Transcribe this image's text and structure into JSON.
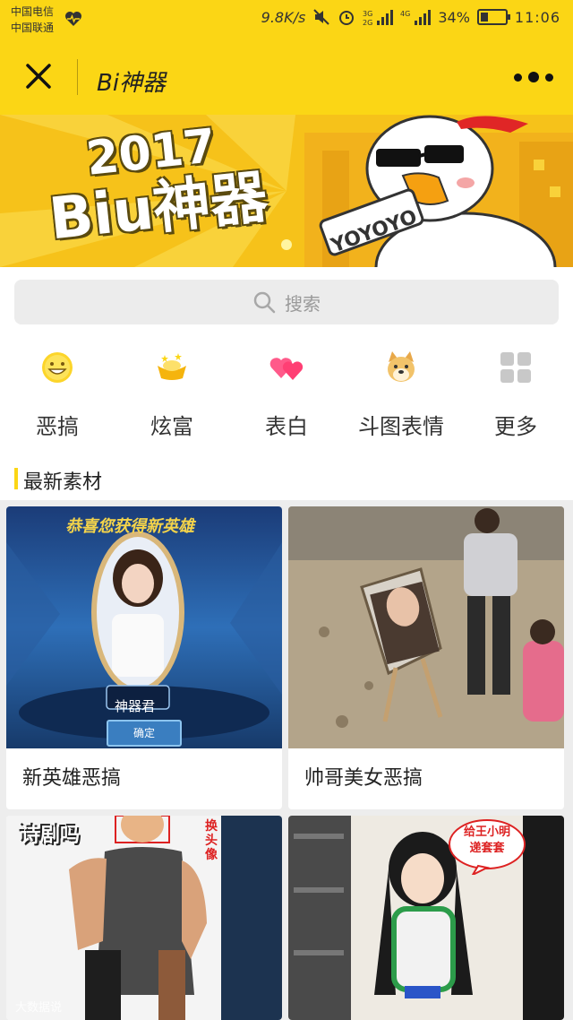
{
  "status": {
    "carrier1": "中国电信",
    "carrier2": "中国联通",
    "speed": "9.8K/s",
    "battery": "34%",
    "time": "11:06"
  },
  "nav": {
    "title": "Bi神器"
  },
  "banner": {
    "year": "2017",
    "name": "Biu神器",
    "sticker": "YOYOYO"
  },
  "search": {
    "placeholder": "搜索"
  },
  "categories": [
    {
      "label": "恶搞",
      "icon": "smiley-face-icon"
    },
    {
      "label": "炫富",
      "icon": "gold-ingot-icon"
    },
    {
      "label": "表白",
      "icon": "hearts-icon"
    },
    {
      "label": "斗图表情",
      "icon": "doge-icon"
    },
    {
      "label": "更多",
      "icon": "grid-icon"
    }
  ],
  "section": {
    "title": "最新素材"
  },
  "cards": [
    {
      "title": "新英雄恶搞",
      "caption": "恭喜您获得新英雄",
      "name": "神器君",
      "button": "确定"
    },
    {
      "title": "帅哥美女恶搞"
    },
    {
      "caption": "诗剧吗",
      "tag": "换头像"
    },
    {
      "bubble": "给王小明递套套"
    }
  ],
  "watermark": "大数据说"
}
